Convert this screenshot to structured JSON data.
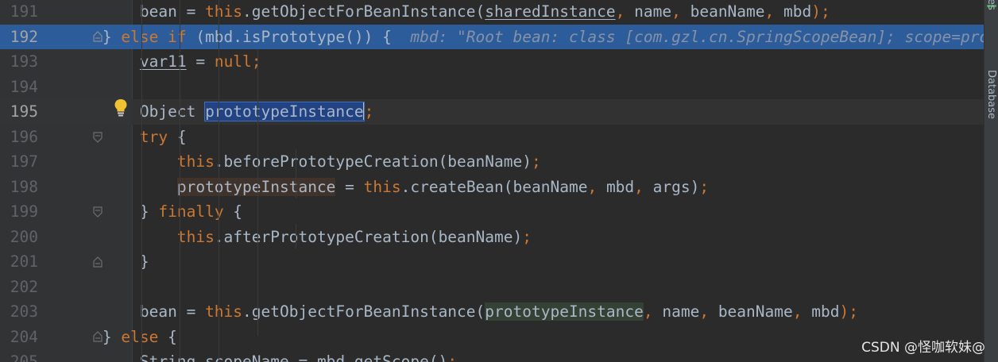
{
  "editor": {
    "lines": [
      {
        "num": "191",
        "tokens": [
          {
            "t": "            bean = ",
            "c": "plain"
          },
          {
            "t": "this",
            "c": "kw"
          },
          {
            "t": ".getObjectForBeanInstance(",
            "c": "plain"
          },
          {
            "t": "sharedInstance",
            "c": "plain u"
          },
          {
            "t": ", ",
            "c": "punct"
          },
          {
            "t": "name",
            "c": "plain"
          },
          {
            "t": ", ",
            "c": "punct"
          },
          {
            "t": "beanName",
            "c": "plain"
          },
          {
            "t": ", ",
            "c": "punct"
          },
          {
            "t": "mbd",
            "c": "plain"
          },
          {
            "t": ");",
            "c": "punct"
          }
        ]
      },
      {
        "num": "192",
        "exec": true,
        "tokens": [
          {
            "t": "        } ",
            "c": "plain"
          },
          {
            "t": "else if ",
            "c": "kw"
          },
          {
            "t": "(mbd.isPrototype()) {  ",
            "c": "plain"
          },
          {
            "t": "mbd: \"Root bean: class [com.gzl.cn.SpringScopeBean]; scope=prototype\"",
            "c": "hint"
          }
        ]
      },
      {
        "num": "193",
        "tokens": [
          {
            "t": "            ",
            "c": "plain"
          },
          {
            "t": "var11",
            "c": "plain u"
          },
          {
            "t": " = ",
            "c": "plain"
          },
          {
            "t": "null",
            "c": "kw"
          },
          {
            "t": ";",
            "c": "punct"
          }
        ]
      },
      {
        "num": "194",
        "tokens": []
      },
      {
        "num": "195",
        "caret": true,
        "tokens": [
          {
            "t": "            Object ",
            "c": "plain"
          },
          {
            "t": "prototypeInstance",
            "c": "plain sel"
          },
          {
            "t": "CARET",
            "c": "caret"
          },
          {
            "t": ";",
            "c": "punct"
          }
        ]
      },
      {
        "num": "196",
        "tokens": [
          {
            "t": "            ",
            "c": "plain"
          },
          {
            "t": "try ",
            "c": "kw"
          },
          {
            "t": "{",
            "c": "plain"
          }
        ]
      },
      {
        "num": "197",
        "tokens": [
          {
            "t": "                ",
            "c": "plain"
          },
          {
            "t": "this",
            "c": "kw"
          },
          {
            "t": ".beforePrototypeCreation(beanName)",
            "c": "plain"
          },
          {
            "t": ";",
            "c": "punct"
          }
        ]
      },
      {
        "num": "198",
        "tokens": [
          {
            "t": "                ",
            "c": "plain"
          },
          {
            "t": "prototypeInstance",
            "c": "plain rw"
          },
          {
            "t": " = ",
            "c": "plain"
          },
          {
            "t": "this",
            "c": "kw"
          },
          {
            "t": ".createBean(beanName",
            "c": "plain"
          },
          {
            "t": ", ",
            "c": "punct"
          },
          {
            "t": "mbd",
            "c": "plain"
          },
          {
            "t": ", ",
            "c": "punct"
          },
          {
            "t": "args)",
            "c": "plain"
          },
          {
            "t": ";",
            "c": "punct"
          }
        ]
      },
      {
        "num": "199",
        "tokens": [
          {
            "t": "            } ",
            "c": "plain"
          },
          {
            "t": "finally ",
            "c": "kw"
          },
          {
            "t": "{",
            "c": "plain"
          }
        ]
      },
      {
        "num": "200",
        "tokens": [
          {
            "t": "                ",
            "c": "plain"
          },
          {
            "t": "this",
            "c": "kw"
          },
          {
            "t": ".afterPrototypeCreation(beanName)",
            "c": "plain"
          },
          {
            "t": ";",
            "c": "punct"
          }
        ]
      },
      {
        "num": "201",
        "tokens": [
          {
            "t": "            }",
            "c": "plain"
          }
        ]
      },
      {
        "num": "202",
        "tokens": []
      },
      {
        "num": "203",
        "tokens": [
          {
            "t": "            bean = ",
            "c": "plain"
          },
          {
            "t": "this",
            "c": "kw"
          },
          {
            "t": ".getObjectForBeanInstance(",
            "c": "plain"
          },
          {
            "t": "prototypeInstance",
            "c": "plain rd"
          },
          {
            "t": ", ",
            "c": "punct"
          },
          {
            "t": "name",
            "c": "plain"
          },
          {
            "t": ", ",
            "c": "punct"
          },
          {
            "t": "beanName",
            "c": "plain"
          },
          {
            "t": ", ",
            "c": "punct"
          },
          {
            "t": "mbd",
            "c": "plain"
          },
          {
            "t": ");",
            "c": "punct"
          }
        ]
      },
      {
        "num": "204",
        "tokens": [
          {
            "t": "        } ",
            "c": "plain"
          },
          {
            "t": "else ",
            "c": "kw"
          },
          {
            "t": "{",
            "c": "plain"
          }
        ]
      },
      {
        "num": "205",
        "tokens": [
          {
            "t": "            String scopeName = mbd.getScope()",
            "c": "plain"
          },
          {
            "t": ";",
            "c": "punct"
          }
        ]
      }
    ]
  },
  "right_strip": {
    "tab_top": "es",
    "tab_database": "Database"
  },
  "watermark": "CSDN @怪咖软妹@",
  "colors": {
    "background": "#2b2b2b",
    "exec_line": "#2d5c9a",
    "keyword": "#cc7832",
    "text": "#a9b7c6"
  },
  "icons": {
    "bulb": "intention-bulb-icon",
    "fold": "fold-marker-icon"
  }
}
